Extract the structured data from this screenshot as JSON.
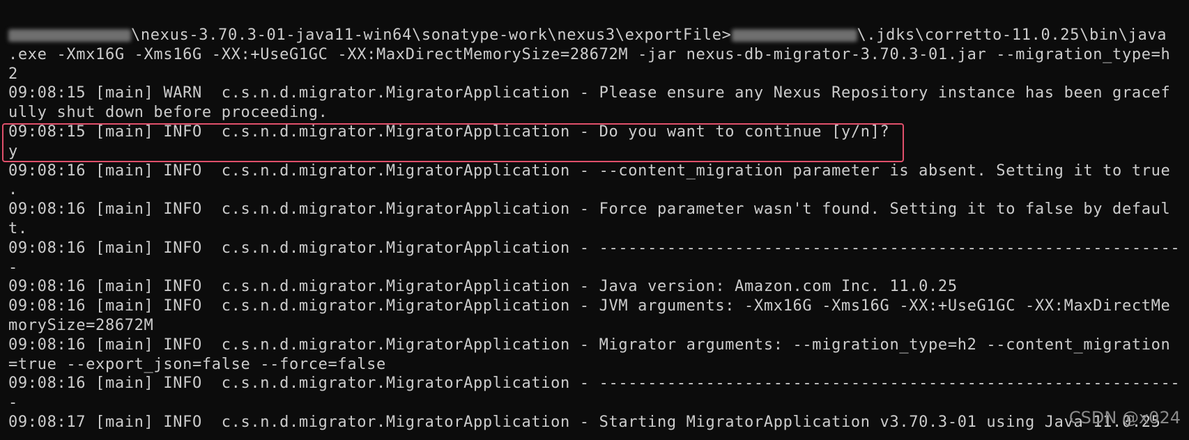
{
  "terminal": {
    "prompt_segment_1": "\\nexus-3.70.3-01-java11-win64\\sonatype-work\\nexus3\\exportFile>",
    "prompt_segment_2": "\\.jdks\\corretto-11.0.25\\bin\\java",
    "lines": [
      ".exe -Xmx16G -Xms16G -XX:+UseG1GC -XX:MaxDirectMemorySize=28672M -jar nexus-db-migrator-3.70.3-01.jar --migration_type=h",
      "2",
      "09:08:15 [main] WARN  c.s.n.d.migrator.MigratorApplication - Please ensure any Nexus Repository instance has been gracef",
      "ully shut down before proceeding.",
      "09:08:15 [main] INFO  c.s.n.d.migrator.MigratorApplication - Do you want to continue [y/n]?",
      "y",
      "09:08:16 [main] INFO  c.s.n.d.migrator.MigratorApplication - --content_migration parameter is absent. Setting it to true",
      ".",
      "09:08:16 [main] INFO  c.s.n.d.migrator.MigratorApplication - Force parameter wasn't found. Setting it to false by defaul",
      "t.",
      "09:08:16 [main] INFO  c.s.n.d.migrator.MigratorApplication - ------------------------------------------------------------",
      "-",
      "09:08:16 [main] INFO  c.s.n.d.migrator.MigratorApplication - Java version: Amazon.com Inc. 11.0.25",
      "09:08:16 [main] INFO  c.s.n.d.migrator.MigratorApplication - JVM arguments: -Xmx16G -Xms16G -XX:+UseG1GC -XX:MaxDirectMe",
      "morySize=28672M",
      "09:08:16 [main] INFO  c.s.n.d.migrator.MigratorApplication - Migrator arguments: --migration_type=h2 --content_migration",
      "=true --export_json=false --force=false",
      "09:08:16 [main] INFO  c.s.n.d.migrator.MigratorApplication - ------------------------------------------------------------",
      "-",
      "09:08:17 [main] INFO  c.s.n.d.migrator.MigratorApplication - Starting MigratorApplication v3.70.3-01 using Java 11.0.25"
    ],
    "highlighted_lines": [
      4,
      5
    ],
    "colors": {
      "background": "#0c0c0c",
      "text": "#cccccc",
      "highlight_border": "#e0506b"
    }
  },
  "watermark": "CSDN @x024"
}
